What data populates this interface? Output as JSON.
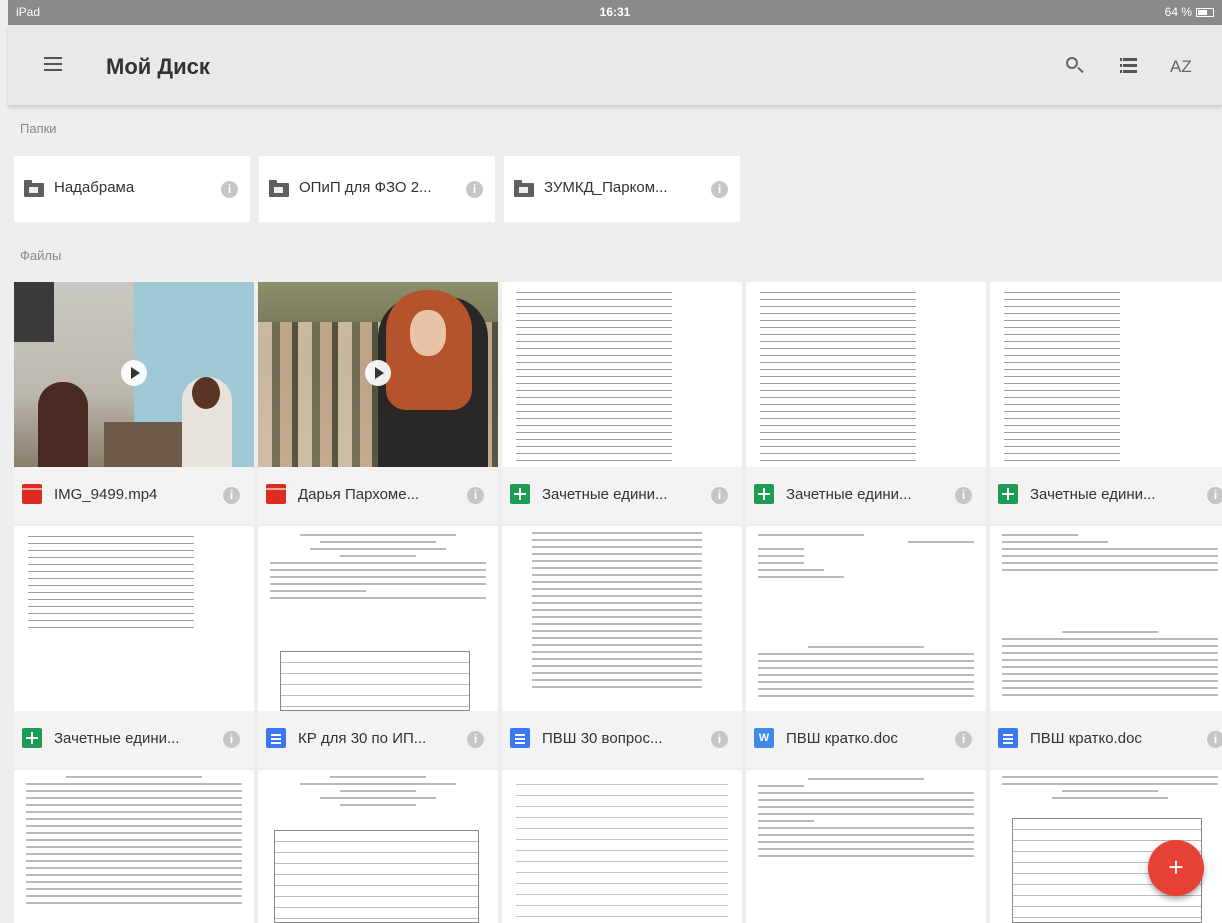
{
  "status_bar": {
    "device": "iPad",
    "time": "16:31",
    "battery": "64 %"
  },
  "app_bar": {
    "title": "Мой Диск",
    "sort_label": "AZ"
  },
  "sections": {
    "folders": "Папки",
    "files": "Файлы"
  },
  "folders": [
    {
      "name": "Надабрама"
    },
    {
      "name": "ОПиП для ФЗО 2..."
    },
    {
      "name": "ЗУМКД_Парком..."
    }
  ],
  "files": [
    {
      "name": "IMG_9499.mp4",
      "type": "video"
    },
    {
      "name": "Дарья Пархоме...",
      "type": "video"
    },
    {
      "name": "Зачетные едини...",
      "type": "spreadsheet"
    },
    {
      "name": "Зачетные едини...",
      "type": "spreadsheet"
    },
    {
      "name": "Зачетные едини...",
      "type": "spreadsheet"
    },
    {
      "name": "Зачетные едини...",
      "type": "spreadsheet"
    },
    {
      "name": "КР для 30 по ИП...",
      "type": "document"
    },
    {
      "name": "ПВШ 30 вопрос...",
      "type": "document"
    },
    {
      "name": "ПВШ кратко.doc",
      "type": "word"
    },
    {
      "name": "ПВШ кратко.doc",
      "type": "document"
    }
  ],
  "fab": {
    "label": "+"
  },
  "colors": {
    "fab": "#e84135",
    "sheet": "#1e9c55",
    "doc": "#3a78f0",
    "video": "#dd2c1f"
  }
}
